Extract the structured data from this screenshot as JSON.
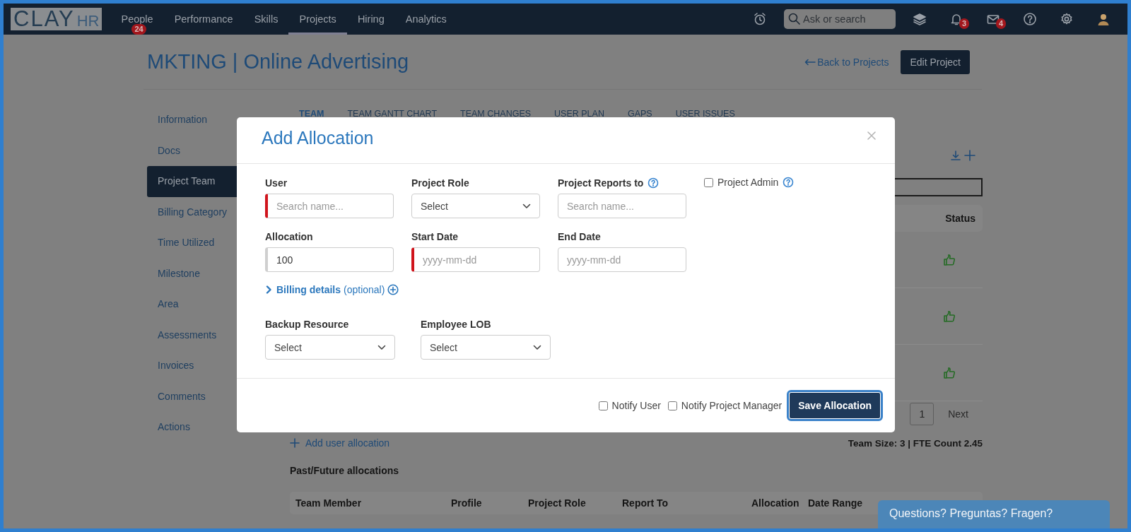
{
  "nav": {
    "logo": {
      "main": "CLAY",
      "accent": "HR"
    },
    "items": [
      {
        "label": "People",
        "selected": false,
        "badge": "24"
      },
      {
        "label": "Performance",
        "selected": false
      },
      {
        "label": "Skills",
        "selected": false
      },
      {
        "label": "Projects",
        "selected": true
      },
      {
        "label": "Hiring",
        "selected": false
      },
      {
        "label": "Analytics",
        "selected": false
      }
    ],
    "search": {
      "placeholder": "Ask or search"
    },
    "icons": [
      {
        "kind": "alarm"
      },
      {
        "kind": "search"
      },
      {
        "kind": "layers"
      },
      {
        "kind": "bell",
        "badge": "3"
      },
      {
        "kind": "mail",
        "badge": "4"
      },
      {
        "kind": "help"
      },
      {
        "kind": "settings"
      },
      {
        "kind": "avatar"
      }
    ]
  },
  "header": {
    "title": "MKTING | Online Advertising",
    "back_link": "Back to Projects",
    "edit_button": "Edit Project"
  },
  "sidebar": {
    "items": [
      {
        "label": "Information",
        "selected": false
      },
      {
        "label": "Docs",
        "selected": false
      },
      {
        "label": "Project Team",
        "selected": true
      },
      {
        "label": "Billing Category",
        "selected": false
      },
      {
        "label": "Time Utilized",
        "selected": false
      },
      {
        "label": "Milestone",
        "selected": false
      },
      {
        "label": "Area",
        "selected": false
      },
      {
        "label": "Assessments",
        "selected": false
      },
      {
        "label": "Invoices",
        "selected": false
      },
      {
        "label": "Comments",
        "selected": false
      },
      {
        "label": "Actions",
        "selected": false
      }
    ]
  },
  "tabs": [
    {
      "label": "TEAM",
      "selected": true
    },
    {
      "label": "TEAM GANTT CHART",
      "selected": false
    },
    {
      "label": "TEAM CHANGES",
      "selected": false
    },
    {
      "label": "USER PLAN",
      "selected": false
    },
    {
      "label": "GAPS",
      "selected": false
    },
    {
      "label": "USER ISSUES",
      "selected": false
    }
  ],
  "team_table": {
    "status_header": "Status",
    "rows": [
      {
        "kind": "approved"
      },
      {
        "kind": "approved"
      },
      {
        "kind": "approved"
      }
    ]
  },
  "pagination": {
    "page": "1",
    "next": "Next"
  },
  "add_link": "Add user allocation",
  "team_summary": "Team Size: 3 | FTE Count 2.45",
  "past_section": {
    "title": "Past/Future allocations",
    "columns": [
      "Team Member",
      "Profile",
      "Project Role",
      "Report To",
      "Allocation",
      "Date Range"
    ]
  },
  "modal": {
    "title": "Add Allocation",
    "rows": [
      [
        {
          "kind": "text",
          "label": "User",
          "placeholder": "Search name...",
          "required": true,
          "prefilled": false
        },
        {
          "kind": "select",
          "label": "Project Role",
          "value": "Select"
        },
        {
          "kind": "text",
          "label": "Project Reports to",
          "placeholder": "Search name...",
          "help": true,
          "required": false,
          "prefilled": false
        },
        {
          "kind": "checkbox",
          "label": "Project Admin",
          "checked": false,
          "help": true
        }
      ],
      [
        {
          "kind": "text",
          "label": "Allocation",
          "value": "100",
          "required": false,
          "prefilled": true
        },
        {
          "kind": "text",
          "label": "Start Date",
          "placeholder": "yyyy-mm-dd",
          "required": true,
          "prefilled": false
        },
        {
          "kind": "text",
          "label": "End Date",
          "placeholder": "yyyy-mm-dd",
          "required": false,
          "prefilled": false
        }
      ]
    ],
    "billing": {
      "label": "Billing details",
      "note": "(optional)",
      "expanded": false
    },
    "lower_row": [
      {
        "kind": "select",
        "label": "Backup Resource",
        "value": "Select"
      },
      {
        "kind": "select",
        "label": "Employee LOB",
        "value": "Select"
      }
    ],
    "footer": {
      "checkboxes": [
        {
          "label": "Notify User",
          "checked": false
        },
        {
          "label": "Notify Project Manager",
          "checked": false
        }
      ],
      "save_button": "Save Allocation"
    }
  },
  "chat_button": "Questions? Preguntas? Fragen?"
}
